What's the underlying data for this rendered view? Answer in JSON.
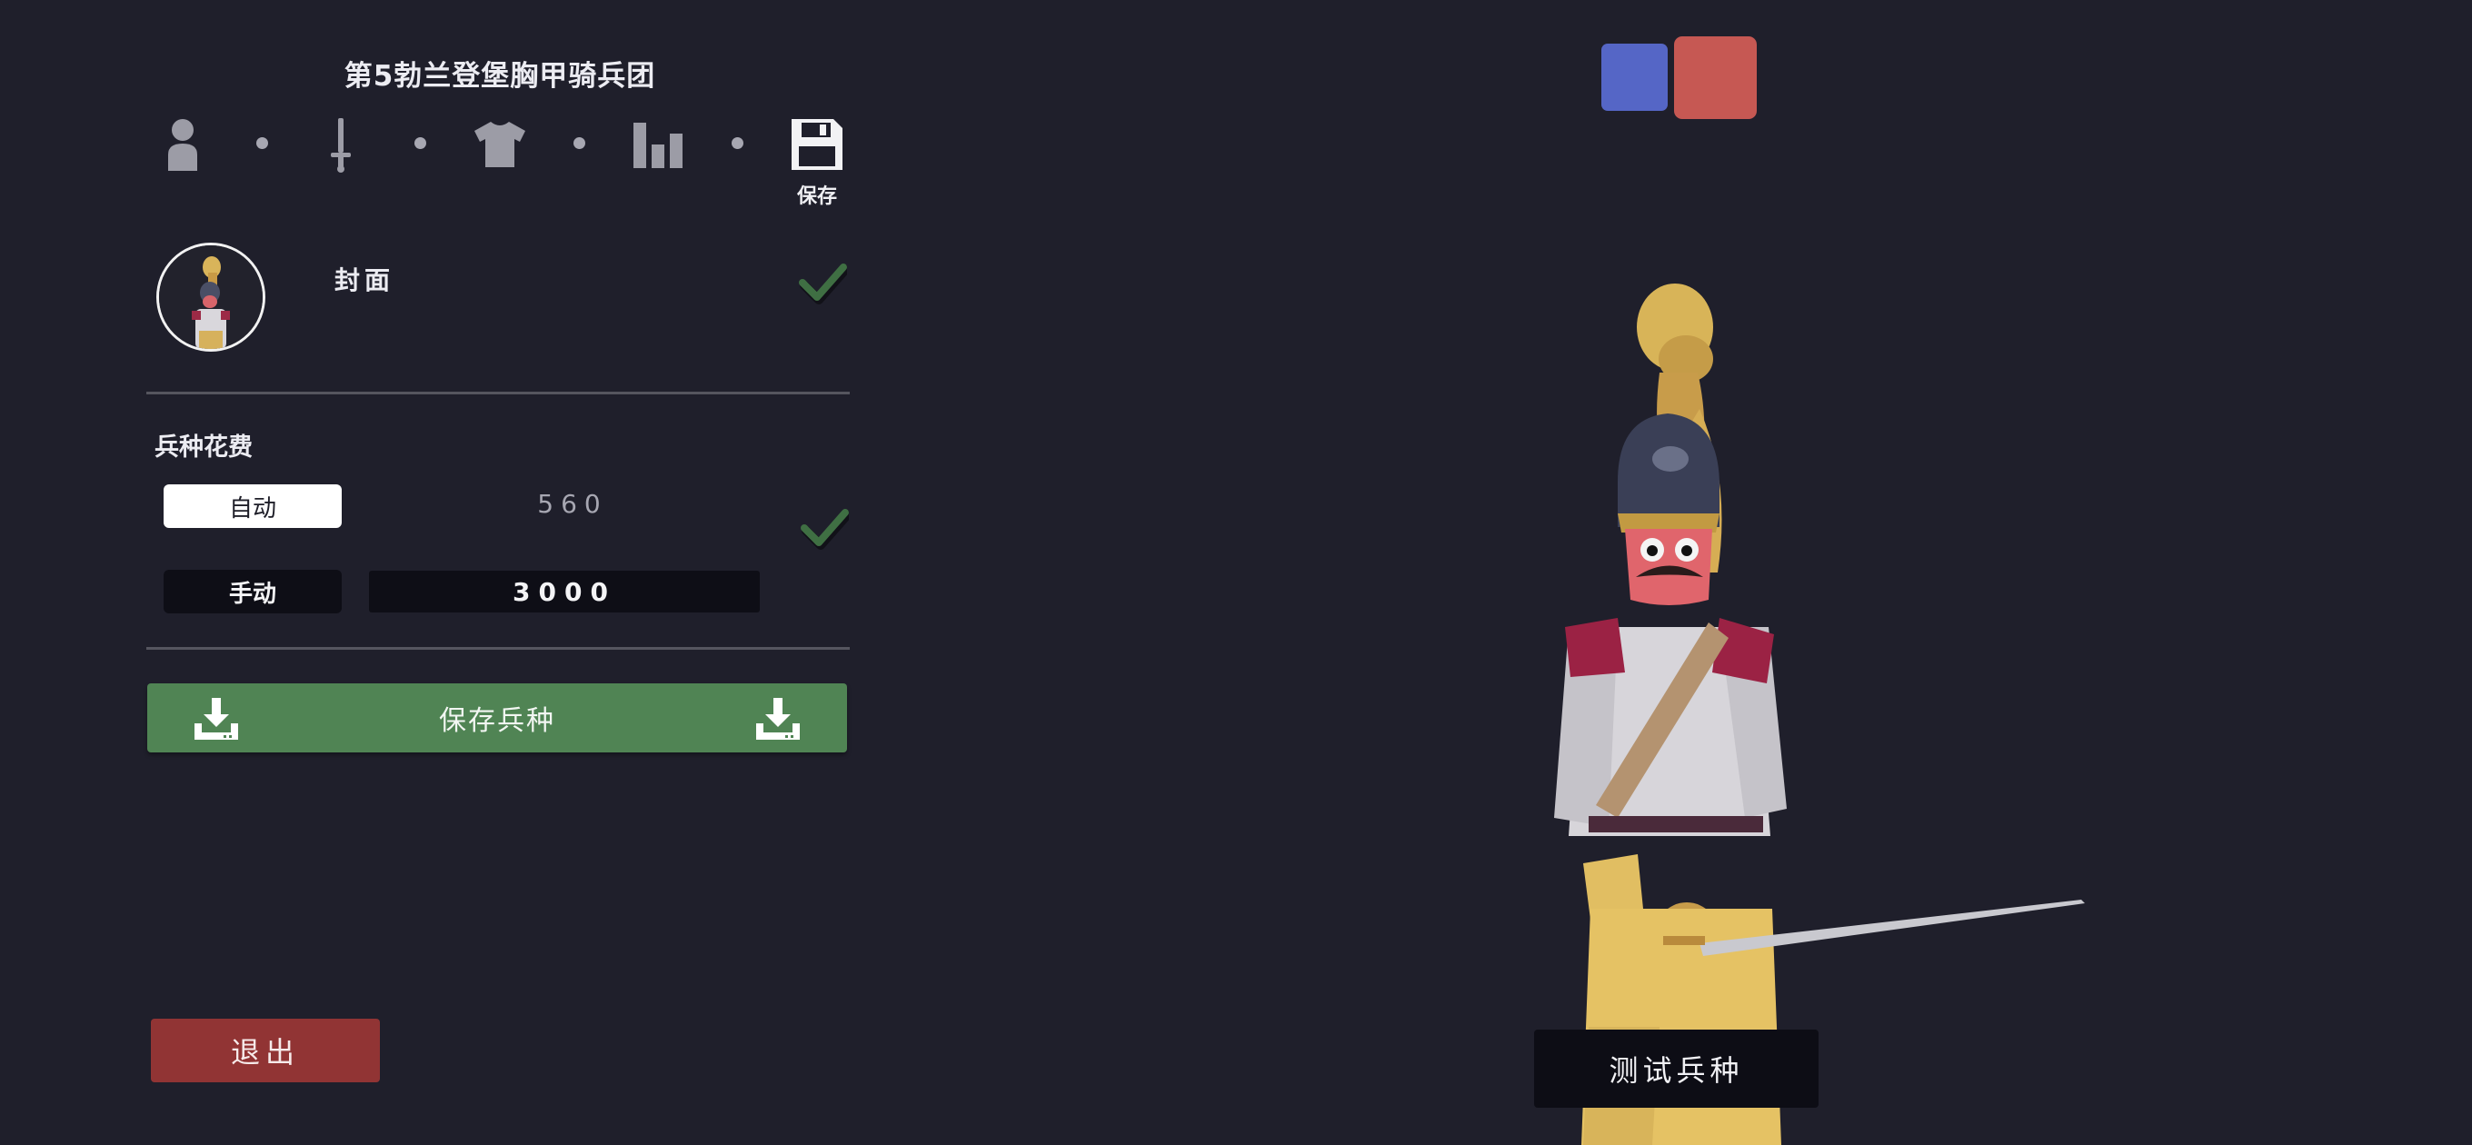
{
  "header": {
    "unit_name": "第5勃兰登堡胸甲骑兵团"
  },
  "steps": {
    "items": [
      {
        "icon": "person-icon"
      },
      {
        "icon": "sword-icon"
      },
      {
        "icon": "shirt-icon"
      },
      {
        "icon": "bar-chart-icon"
      },
      {
        "icon": "floppy-disk-icon",
        "label": "保存"
      }
    ],
    "active": 4
  },
  "cover": {
    "label": "封面",
    "checked": true
  },
  "cost": {
    "heading": "兵种花费",
    "auto_label": "自动",
    "auto_value": "560",
    "manual_label": "手动",
    "manual_value": "3000",
    "selected_mode": "手动"
  },
  "actions": {
    "save_unit_label": "保存兵种",
    "exit_label": "退出",
    "test_unit_label": "测试兵种"
  },
  "teams": {
    "blue_color": "#5566c6",
    "red_color": "#c65853",
    "selected": "red"
  },
  "colors": {
    "background": "#1f1f2b",
    "save_button": "#508454",
    "exit_button": "#913434",
    "check_mark": "#3f6f43"
  }
}
